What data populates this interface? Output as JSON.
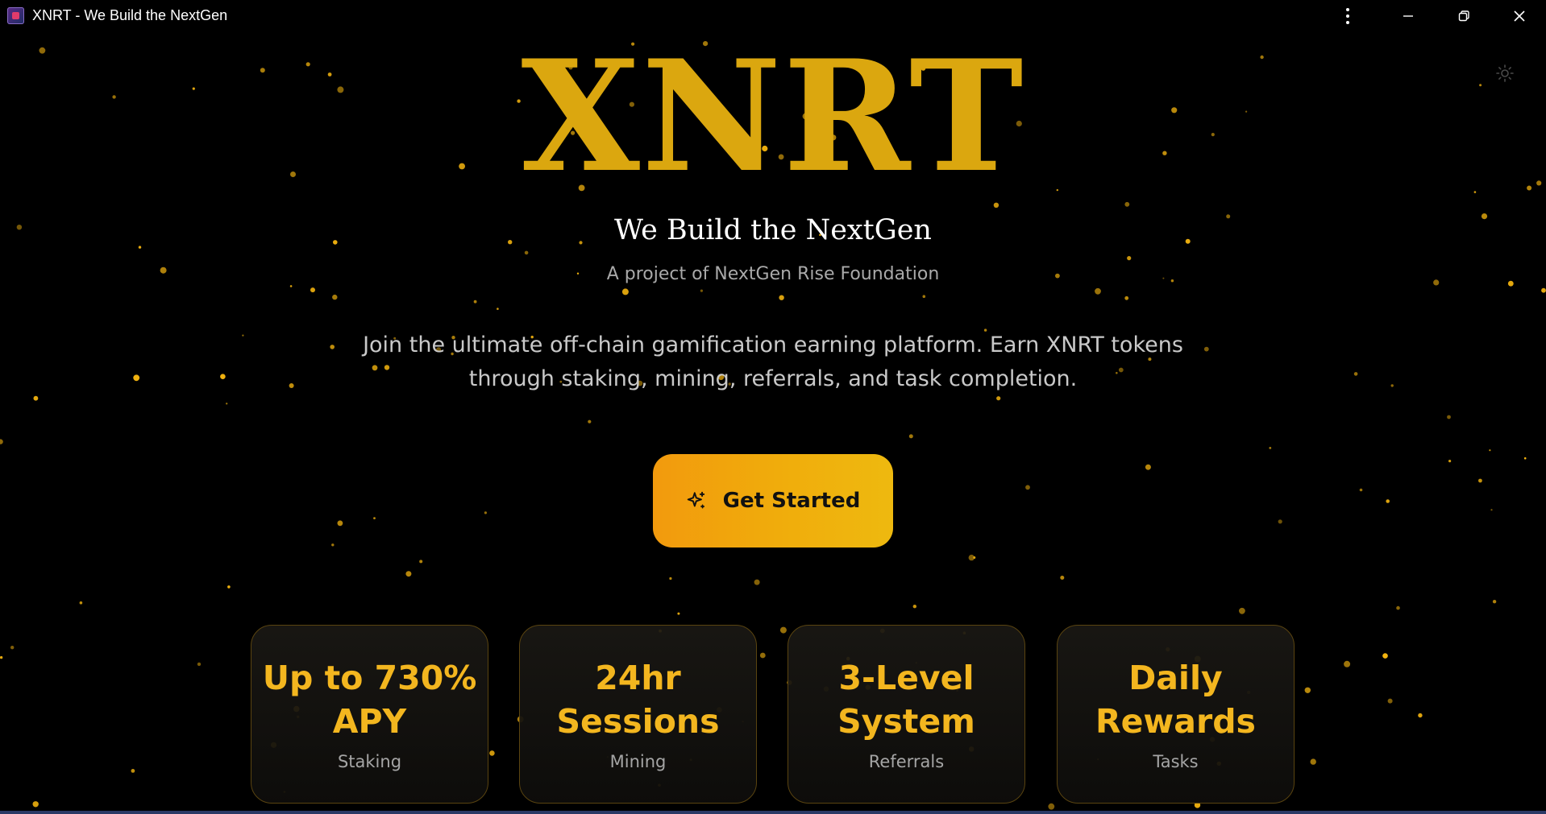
{
  "window": {
    "title": "XNRT - We Build the NextGen"
  },
  "hero": {
    "logo": "XNRT",
    "tagline": "We Build the NextGen",
    "subtitle": "A project of NextGen Rise Foundation",
    "description": "Join the ultimate off-chain gamification earning platform. Earn XNRT tokens through staking, mining, referrals, and task completion.",
    "cta_label": "Get Started",
    "cta_icon": "sparkle-icon"
  },
  "features": [
    {
      "value": "Up to 730% APY",
      "label": "Staking"
    },
    {
      "value": "24hr Sessions",
      "label": "Mining"
    },
    {
      "value": "3-Level System",
      "label": "Referrals"
    },
    {
      "value": "Daily Rewards",
      "label": "Tasks"
    }
  ],
  "colors": {
    "background": "#000000",
    "logo": "#dba70f",
    "accent": "#f3b61f",
    "cta_start": "#f29a0d",
    "cta_end": "#eeb90f",
    "star": "#f5b50f"
  },
  "icons": {
    "theme_toggle": "sun-icon",
    "menu": "kebab-menu-icon",
    "minimize": "minimize-icon",
    "maximize": "restore-icon",
    "close": "close-icon"
  }
}
